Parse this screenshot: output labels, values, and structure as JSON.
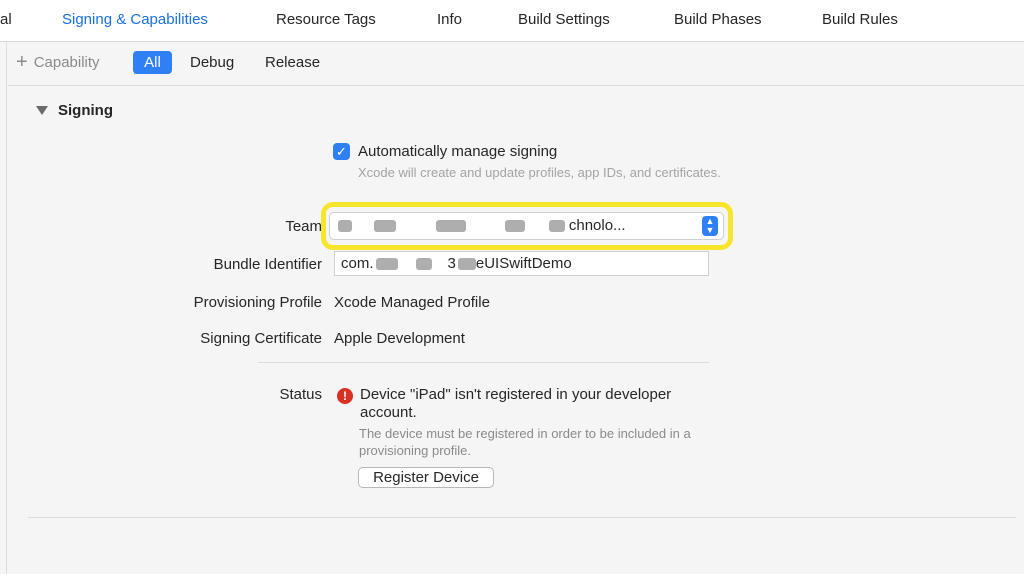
{
  "tabs": {
    "general_partial": "al",
    "signing": "Signing & Capabilities",
    "resource_tags": "Resource Tags",
    "info": "Info",
    "build_settings": "Build Settings",
    "build_phases": "Build Phases",
    "build_rules": "Build Rules"
  },
  "toolbar": {
    "capability": "Capability",
    "all": "All",
    "debug": "Debug",
    "release": "Release"
  },
  "signing": {
    "section_title": "Signing",
    "auto_manage": "Automatically manage signing",
    "auto_manage_desc": "Xcode will create and update profiles, app IDs, and certificates.",
    "team_label": "Team",
    "team_value": "chnolo...",
    "bundle_label": "Bundle Identifier",
    "bundle_value_prefix": "com.",
    "bundle_value_suffix": "eUISwiftDemo",
    "bundle_value_mid": "3",
    "profile_label": "Provisioning Profile",
    "profile_value": "Xcode Managed Profile",
    "cert_label": "Signing Certificate",
    "cert_value": "Apple Development",
    "status_label": "Status",
    "status_msg": "Device \"iPad\" isn't registered in your developer account.",
    "status_desc": "The device must be registered in order to be included in a provisioning profile.",
    "register_button": "Register Device"
  },
  "colors": {
    "accent": "#2f7ff5",
    "active_tab": "#1a6fe0",
    "highlight": "#f6e62b",
    "error": "#d93025"
  }
}
